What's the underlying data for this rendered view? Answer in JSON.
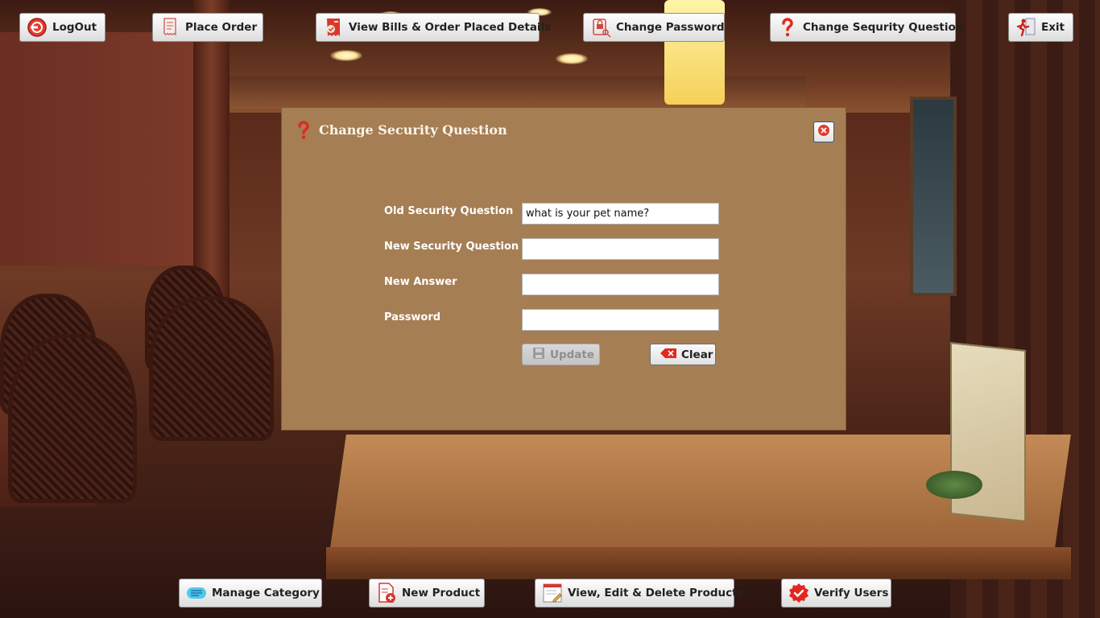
{
  "top_toolbar": [
    {
      "id": "logout",
      "label": "LogOut",
      "icon": "logout-icon"
    },
    {
      "id": "place-order",
      "label": "Place Order",
      "icon": "receipt-icon"
    },
    {
      "id": "view-bills",
      "label": "View Bills & Order Placed Details",
      "icon": "bill-icon"
    },
    {
      "id": "change-password",
      "label": "Change Password",
      "icon": "lock-key-icon"
    },
    {
      "id": "change-security-question",
      "label": "Change Sequrity Question",
      "icon": "question-icon"
    },
    {
      "id": "exit",
      "label": "Exit",
      "icon": "exit-run-icon"
    }
  ],
  "bottom_toolbar": [
    {
      "id": "manage-category",
      "label": "Manage Category",
      "icon": "category-icon"
    },
    {
      "id": "new-product",
      "label": "New Product",
      "icon": "new-product-icon"
    },
    {
      "id": "view-edit-delete-products",
      "label": "View, Edit & Delete Products",
      "icon": "edit-document-icon"
    },
    {
      "id": "verify-users",
      "label": "Verify Users",
      "icon": "verified-badge-icon"
    }
  ],
  "dialog": {
    "title": "Change Security Question",
    "title_icon": "question-icon",
    "close_icon": "close-icon",
    "fields": {
      "old_question": {
        "label": "Old Security Question",
        "value": "what is your pet name?"
      },
      "new_question": {
        "label": "New Security Question",
        "value": ""
      },
      "new_answer": {
        "label": "New Answer",
        "value": ""
      },
      "password": {
        "label": "Password",
        "value": ""
      }
    },
    "update_button": {
      "label": "Update",
      "icon": "save-disk-icon",
      "enabled": false
    },
    "clear_button": {
      "label": "Clear",
      "icon": "clear-x-icon"
    }
  },
  "colors": {
    "dialog_background": "#a67e54",
    "label_text": "#ffffff",
    "button_face": "#ececec"
  }
}
